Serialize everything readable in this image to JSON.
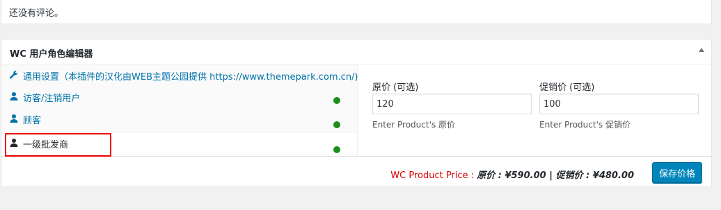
{
  "comments": {
    "no_comments_text": "还没有评论。"
  },
  "metabox": {
    "title": "WC 用户角色编辑器",
    "tabs": [
      {
        "label": "通用设置（本插件的汉化由WEB主题公园提供 https://www.themepark.com.cn/)",
        "icon": "wrench-icon",
        "has_status": false
      },
      {
        "label": "访客/注销用户",
        "icon": "user-icon",
        "has_status": true
      },
      {
        "label": "顾客",
        "icon": "user-icon",
        "has_status": true
      },
      {
        "label": "一级批发商",
        "icon": "user-icon",
        "has_status": true,
        "active": true
      }
    ],
    "status_color": "#1a8f1a",
    "fields": {
      "regular": {
        "label": "原价 (可选)",
        "value": "120",
        "desc": "Enter Product's 原价"
      },
      "sale": {
        "label": "促销价 (可选)",
        "value": "100",
        "desc": "Enter Product's 促销价"
      }
    },
    "footer": {
      "prefix": "WC Product Price : ",
      "regular_label": "原价",
      "regular_value": "¥590.00",
      "separator": " | ",
      "sale_label": "促销价",
      "sale_value": "¥480.00",
      "save_label": "保存价格"
    }
  },
  "colors": {
    "accent": "#0085ba",
    "link": "#0073aa",
    "price_prefix": "#dd0000",
    "highlight": "#ee0000"
  }
}
